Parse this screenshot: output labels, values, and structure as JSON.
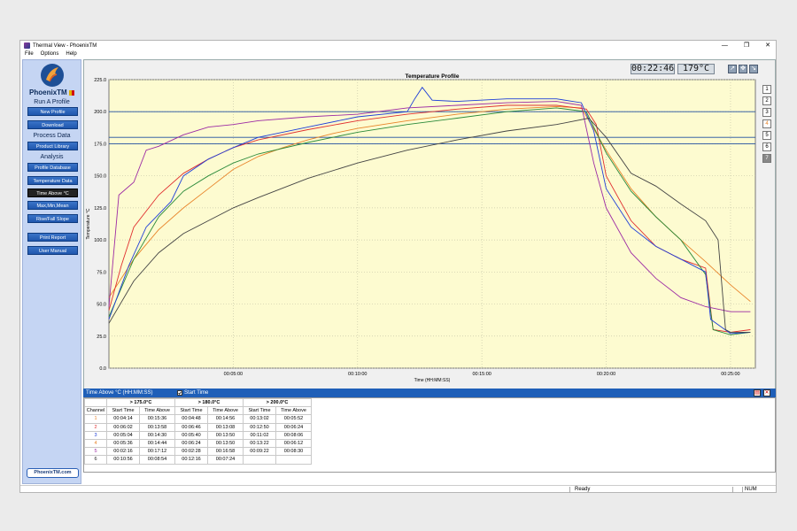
{
  "window": {
    "title": "Thermal View - PhoenixTM",
    "controls": [
      "—",
      "❐",
      "✕"
    ]
  },
  "menu": [
    "File",
    "Options",
    "Help"
  ],
  "logo_text": "PhoenixTM",
  "sidebar": {
    "run_header": "Run A Profile",
    "process_header": "Process Data",
    "analysis_header": "Analysis",
    "buttons": {
      "new_profile": "New Profile",
      "download": "Download",
      "product_library": "Product Library",
      "profile_database": "Profile Database",
      "temperature_data": "Temperature Data",
      "time_above": "Time Above °C",
      "max_min_mean": "Max,Min,Mean",
      "rise_fall_slope": "Rise/Fall Slope",
      "print_report": "Print Report",
      "user_manual": "User Manual"
    },
    "site_link": "PhoenixTM.com"
  },
  "readouts": {
    "time": "00:22:46",
    "temp": "179°C"
  },
  "channel_buttons": [
    "1",
    "2",
    "3",
    "4",
    "5",
    "6",
    "7"
  ],
  "chart_data": {
    "type": "line",
    "title": "Temperature Profile",
    "xlabel": "Time (HH:MM:SS)",
    "ylabel": "Temperature °C",
    "ylim": [
      0,
      225
    ],
    "y_ticks": [
      "0.0",
      "25.0",
      "50.0",
      "75.0",
      "100.0",
      "125.0",
      "150.0",
      "175.0",
      "200.0",
      "225.0"
    ],
    "x_ticks": [
      "00:05:00",
      "00:10:00",
      "00:15:00",
      "00:20:00",
      "00:25:00"
    ],
    "x_tick_minutes": [
      5,
      10,
      15,
      20,
      25
    ],
    "xlim_minutes": [
      0,
      26
    ],
    "threshold_lines": [
      175,
      180,
      200
    ],
    "background": "#fdfbd0",
    "series": [
      {
        "color": "#e8842a",
        "points": [
          [
            0,
            55
          ],
          [
            1,
            85
          ],
          [
            2,
            108
          ],
          [
            3,
            125
          ],
          [
            4,
            140
          ],
          [
            5,
            155
          ],
          [
            6,
            165
          ],
          [
            7,
            172
          ],
          [
            8,
            178
          ],
          [
            9,
            183
          ],
          [
            10,
            187
          ],
          [
            12,
            193
          ],
          [
            14,
            198
          ],
          [
            16,
            202
          ],
          [
            18,
            204
          ],
          [
            19,
            203
          ],
          [
            20,
            170
          ],
          [
            21,
            140
          ],
          [
            22,
            118
          ],
          [
            23,
            100
          ],
          [
            24,
            83
          ],
          [
            25,
            65
          ],
          [
            25.8,
            52
          ]
        ]
      },
      {
        "color": "#e03030",
        "points": [
          [
            0,
            45
          ],
          [
            0.5,
            80
          ],
          [
            1,
            110
          ],
          [
            2,
            135
          ],
          [
            3,
            152
          ],
          [
            4,
            163
          ],
          [
            5,
            172
          ],
          [
            6,
            178
          ],
          [
            8,
            186
          ],
          [
            10,
            193
          ],
          [
            12,
            198
          ],
          [
            14,
            202
          ],
          [
            16,
            205
          ],
          [
            18,
            205
          ],
          [
            19.2,
            202
          ],
          [
            19.6,
            190
          ],
          [
            20,
            150
          ],
          [
            21,
            115
          ],
          [
            22,
            95
          ],
          [
            23,
            85
          ],
          [
            24,
            78
          ],
          [
            24.3,
            30
          ],
          [
            25,
            28
          ],
          [
            25.8,
            30
          ]
        ]
      },
      {
        "color": "#2a8a3a",
        "points": [
          [
            0,
            40
          ],
          [
            1,
            85
          ],
          [
            2,
            118
          ],
          [
            3,
            138
          ],
          [
            4,
            150
          ],
          [
            5,
            160
          ],
          [
            6,
            167
          ],
          [
            8,
            176
          ],
          [
            10,
            184
          ],
          [
            12,
            190
          ],
          [
            14,
            195
          ],
          [
            16,
            200
          ],
          [
            18,
            203
          ],
          [
            19.2,
            200
          ],
          [
            20,
            168
          ],
          [
            21,
            138
          ],
          [
            22,
            118
          ],
          [
            23,
            100
          ],
          [
            24,
            73
          ],
          [
            24.3,
            30
          ],
          [
            25,
            26
          ],
          [
            25.8,
            28
          ]
        ]
      },
      {
        "color": "#1f3fd8",
        "points": [
          [
            0,
            38
          ],
          [
            0.8,
            80
          ],
          [
            1.5,
            110
          ],
          [
            2,
            120
          ],
          [
            2.5,
            130
          ],
          [
            3,
            150
          ],
          [
            4,
            163
          ],
          [
            5,
            172
          ],
          [
            6,
            180
          ],
          [
            8,
            188
          ],
          [
            10,
            196
          ],
          [
            12,
            200
          ],
          [
            12.3,
            210
          ],
          [
            12.6,
            219
          ],
          [
            13,
            209
          ],
          [
            14,
            208
          ],
          [
            16,
            210
          ],
          [
            18,
            210
          ],
          [
            19,
            207
          ],
          [
            19.5,
            185
          ],
          [
            20,
            140
          ],
          [
            21,
            110
          ],
          [
            22,
            95
          ],
          [
            23,
            85
          ],
          [
            24,
            75
          ],
          [
            24.2,
            38
          ],
          [
            25,
            27
          ],
          [
            25.8,
            28
          ]
        ]
      },
      {
        "color": "#9c2aa4",
        "points": [
          [
            0,
            48
          ],
          [
            0.4,
            135
          ],
          [
            1,
            145
          ],
          [
            1.5,
            170
          ],
          [
            2,
            173
          ],
          [
            3,
            182
          ],
          [
            4,
            188
          ],
          [
            5,
            190
          ],
          [
            6,
            193
          ],
          [
            8,
            196
          ],
          [
            10,
            198
          ],
          [
            12,
            203
          ],
          [
            14,
            205
          ],
          [
            16,
            207
          ],
          [
            18,
            208
          ],
          [
            19,
            205
          ],
          [
            19.5,
            160
          ],
          [
            20,
            125
          ],
          [
            21,
            90
          ],
          [
            22,
            70
          ],
          [
            23,
            55
          ],
          [
            24,
            48
          ],
          [
            25,
            44
          ],
          [
            25.8,
            44
          ]
        ]
      },
      {
        "color": "#444444",
        "points": [
          [
            0,
            35
          ],
          [
            1,
            68
          ],
          [
            2,
            90
          ],
          [
            3,
            105
          ],
          [
            4,
            115
          ],
          [
            5,
            125
          ],
          [
            6,
            133
          ],
          [
            8,
            148
          ],
          [
            10,
            160
          ],
          [
            12,
            170
          ],
          [
            14,
            178
          ],
          [
            16,
            185
          ],
          [
            18,
            190
          ],
          [
            19.3,
            195
          ],
          [
            20,
            180
          ],
          [
            21,
            152
          ],
          [
            22,
            142
          ],
          [
            23,
            128
          ],
          [
            24,
            115
          ],
          [
            24.5,
            100
          ],
          [
            24.8,
            30
          ],
          [
            25,
            28
          ],
          [
            25.8,
            28
          ]
        ]
      }
    ]
  },
  "time_above": {
    "header_label": "Time Above °C (HH:MM:SS)",
    "start_time_label": "Start Time",
    "groups": [
      "> 175.0°C",
      "> 180.0°C",
      "> 200.0°C"
    ],
    "col_headers": [
      "Channel",
      "Start Time",
      "Time Above",
      "Start Time",
      "Time Above",
      "Start Time",
      "Time Above"
    ],
    "rows": [
      {
        "ch": "1",
        "color": "#e8842a",
        "vals": [
          "00:04:14",
          "00:15:36",
          "00:04:48",
          "00:14:56",
          "00:13:02",
          "00:05:52"
        ]
      },
      {
        "ch": "2",
        "color": "#e03030",
        "vals": [
          "00:06:02",
          "00:13:58",
          "00:06:46",
          "00:13:08",
          "00:12:50",
          "00:06:24"
        ]
      },
      {
        "ch": "3",
        "color": "#1f3fd8",
        "vals": [
          "00:05:04",
          "00:14:30",
          "00:05:40",
          "00:13:50",
          "00:11:02",
          "00:08:06"
        ]
      },
      {
        "ch": "4",
        "color": "#e8842a",
        "vals": [
          "00:05:36",
          "00:14:44",
          "00:06:24",
          "00:13:50",
          "00:13:22",
          "00:06:12"
        ]
      },
      {
        "ch": "5",
        "color": "#9c2aa4",
        "vals": [
          "00:02:16",
          "00:17:12",
          "00:02:28",
          "00:16:58",
          "00:09:22",
          "00:08:30"
        ]
      },
      {
        "ch": "6",
        "color": "#222222",
        "vals": [
          "00:10:56",
          "00:08:54",
          "00:12:16",
          "00:07:24",
          "",
          ""
        ]
      }
    ]
  },
  "status": {
    "ready": "Ready",
    "num": "NUM"
  }
}
